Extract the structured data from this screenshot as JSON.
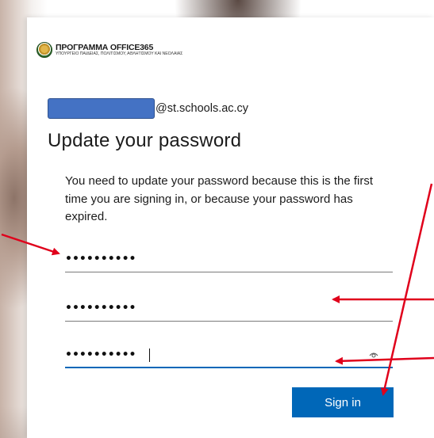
{
  "branding": {
    "title": "ΠΡΟΓΡΑΜΜΑ OFFICE365",
    "subtitle": "ΥΠΟΥΡΓΕΙΟ ΠΑΙΔΕΙΑΣ, ΠΟΛΙΤΙΣΜΟΥ, ΑΘΛΗΤΙΣΜΟΥ ΚΑΙ ΝΕΟΛΑΙΑΣ"
  },
  "account": {
    "email_domain": "@st.schools.ac.cy"
  },
  "page": {
    "title": "Update your password",
    "message": "You need to update your password because this is the first time you are signing in, or because your password has expired."
  },
  "fields": {
    "current_password": {
      "value": "••••••••••"
    },
    "new_password": {
      "value": "••••••••••"
    },
    "confirm_password": {
      "value": "••••••••••"
    }
  },
  "actions": {
    "sign_in_label": "Sign in"
  },
  "colors": {
    "accent": "#0067b8",
    "annotation": "#e0001b",
    "redaction": "#4472c4"
  },
  "icons": {
    "reveal": "eye-icon",
    "crest": "cyprus-crest-logo"
  }
}
